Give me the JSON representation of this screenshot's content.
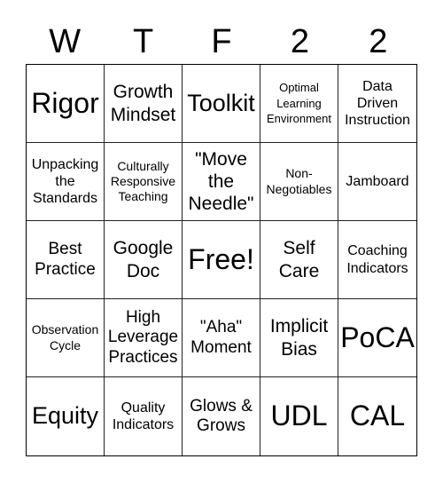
{
  "header": {
    "letters": [
      "W",
      "T",
      "F",
      "2",
      "2"
    ]
  },
  "board": {
    "cells": [
      "Rigor",
      "Growth Mindset",
      "Toolkit",
      "Optimal Learning Environment",
      "Data Driven Instruction",
      "Unpacking the Standards",
      "Culturally Responsive Teaching",
      "\"Move the Needle\"",
      "Non-Negotiables",
      "Jamboard",
      "Best Practice",
      "Google Doc",
      "Free!",
      "Self Care",
      "Coaching Indicators",
      "Observation Cycle",
      "High Leverage Practices",
      "\"Aha\" Moment",
      "Implicit Bias",
      "PoCA",
      "Equity",
      "Quality Indicators",
      "Glows & Grows",
      "UDL",
      "CAL"
    ]
  }
}
